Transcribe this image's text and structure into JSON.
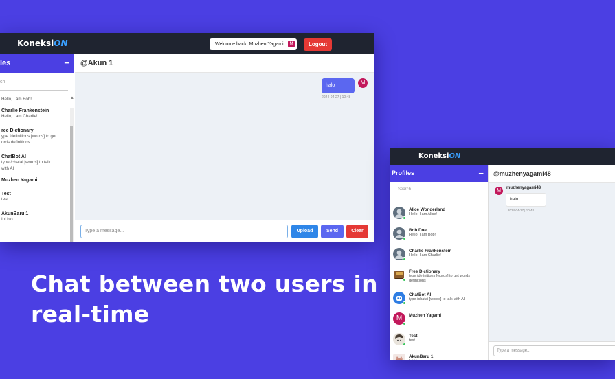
{
  "brand": {
    "name": "Koneksi",
    "suffix": "ON"
  },
  "window1": {
    "welcome": "Welcome back, Muzhen Yagami",
    "welcome_avatar": "M",
    "logout": "Logout",
    "sidebar_title": "les",
    "search_placeholder": "ch",
    "first_bio": "Hello, I am Bob!",
    "profiles": [
      {
        "name": "Charlie Frankenstein",
        "bio": "Hello, I am Charlie!"
      },
      {
        "name": "ree Dictionary",
        "bio": "ype /definitions [words] to get\nords definitions"
      },
      {
        "name": "ChatBot AI",
        "bio": "type /chatai [words] to talk\nwith AI"
      },
      {
        "name": "Muzhen Yagami",
        "bio": ""
      },
      {
        "name": "Test",
        "bio": "test"
      },
      {
        "name": "AkunBaru 1",
        "bio": "Ini bio"
      }
    ],
    "chat_title": "@Akun 1",
    "message": {
      "text": "halo",
      "time": "2024-04-27 | 10:48",
      "avatar": "M"
    },
    "input_placeholder": "Type a message...",
    "buttons": {
      "upload": "Upload",
      "send": "Send",
      "clear": "Clear"
    }
  },
  "headline": {
    "line1": "Chat between two users in",
    "line2": "real-time"
  },
  "window2": {
    "sidebar_title": "Profiles",
    "search_placeholder": "Search",
    "profiles": [
      {
        "name": "Alice Wonderland",
        "bio": "Hello, I am Alice!",
        "avatar": "gray-person"
      },
      {
        "name": "Bob Doe",
        "bio": "Hello, I am Bob!",
        "avatar": "gray-person"
      },
      {
        "name": "Charlie Frankenstein",
        "bio": "Hello, I am Charlie!",
        "avatar": "gray-person"
      },
      {
        "name": "Free Dictionary",
        "bio": "type /definitions [words] to get words\ndefinitions",
        "avatar": "book"
      },
      {
        "name": "ChatBot AI",
        "bio": "type /chatai [words] to talk with AI",
        "avatar": "robot"
      },
      {
        "name": "Muzhen Yagami",
        "bio": "",
        "avatar": "M"
      },
      {
        "name": "Test",
        "bio": "test",
        "avatar": "anime"
      },
      {
        "name": "AkunBaru 1",
        "bio": "Ini bio",
        "avatar": "cat"
      }
    ],
    "chat_title": "@muzhenyagami48",
    "message": {
      "sender": "muzhenyagami48",
      "text": "halo",
      "time": "2024-04-27 | 10:48",
      "avatar": "M"
    },
    "input_placeholder": "Type a message..."
  },
  "colors": {
    "background": "#4b3fe3",
    "topbar": "#1f2430",
    "accent": "#4b3fe3",
    "logout": "#e53935",
    "upload": "#2e86e8",
    "send": "#5b67f0",
    "clear": "#e53935"
  }
}
